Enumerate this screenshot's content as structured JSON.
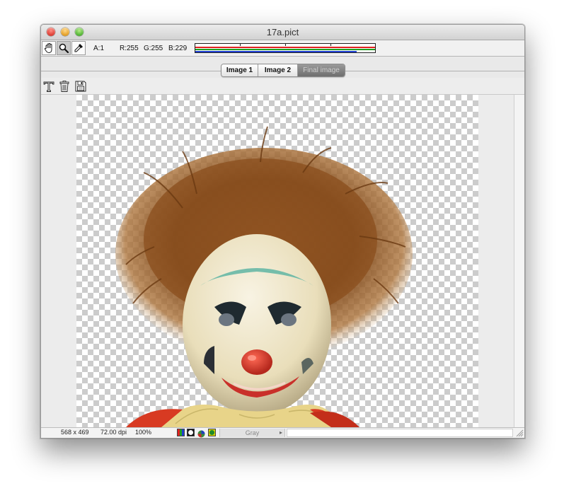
{
  "window": {
    "title": "17a.pict"
  },
  "toolbar": {
    "tools": [
      {
        "name": "hand-tool",
        "icon": "hand-icon"
      },
      {
        "name": "zoom-tool",
        "icon": "magnifier-icon"
      },
      {
        "name": "eyedropper-tool",
        "icon": "eyedropper-icon"
      }
    ],
    "alpha": "A:1",
    "red": "R:255",
    "green": "G:255",
    "blue": "B:229",
    "rgb_levels": {
      "red": 255,
      "green": 255,
      "blue": 229,
      "max": 255
    }
  },
  "view_tabs": {
    "items": [
      "Image 1",
      "Image 2",
      "Final image"
    ],
    "selected": "Final image"
  },
  "actions": [
    {
      "name": "text-tool",
      "icon": "text-icon"
    },
    {
      "name": "delete",
      "icon": "trash-icon"
    },
    {
      "name": "save",
      "icon": "floppy-disk-icon"
    }
  ],
  "status": {
    "dimensions": "568 x 469",
    "resolution": "72.00 dpi",
    "zoom": "100%",
    "channel_mode": "Gray",
    "channel_icons": [
      "rgb-channels-icon",
      "circle-mask-icon",
      "color-wheel-icon",
      "green-yellow-icon"
    ]
  },
  "colors": {
    "red_bar": "#e02020",
    "green_bar": "#1ea01e",
    "blue_bar": "#2040d0",
    "hair": "#7a4a22",
    "face": "#efe6cc",
    "nose": "#d2352a",
    "costume": "#d83a22",
    "collar": "#e8d489"
  }
}
